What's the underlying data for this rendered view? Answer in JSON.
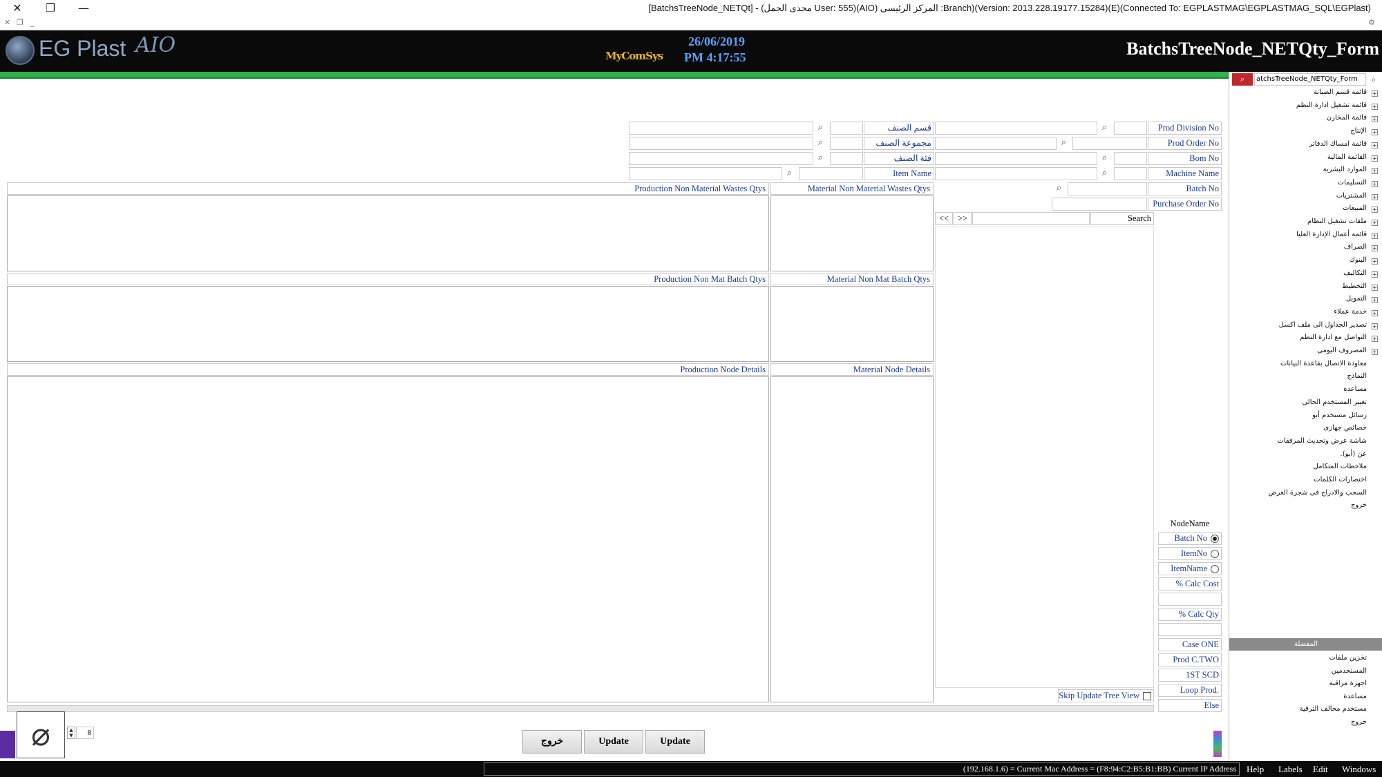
{
  "window": {
    "title": "[BatchsTreeNode_NETQt] - (مجدى الجمل User: 555)(AIO) المركز الرئيسى :Branch)(Version: 2013.228.19177.15284)(E)(Connected To: EGPLASTMAG\\EGPLASTMAG_SQL\\EGPlast)",
    "close": "✕",
    "restore": "❐",
    "minimize": "—"
  },
  "header": {
    "logo": "EG Plast",
    "logo_suffix": "AIO",
    "company_mark": "MyComSys",
    "date": "26/06/2019",
    "time": "PM 4:17:55",
    "form_title": "BatchsTreeNode_NETQty_Form"
  },
  "fields": {
    "prod_division_no": "Prod Division No",
    "prod_order_no": "Prod Order No",
    "bom_no": "Bom No",
    "machine_name": "Machine Name",
    "batch_no": "Batch No",
    "purchase_order_no": "Purchase Order No",
    "item_section": "قسم الصنف",
    "item_group": "مجموعة الصنف",
    "item_category": "فئة الصنف",
    "item_name": "Item Name",
    "search": "Search",
    "prev": "<<",
    "next": ">>"
  },
  "panels": {
    "prod_non_mat_wastes": "Production Non Material Wastes Qtys",
    "mat_non_mat_wastes": "Material Non Material Wastes Qtys",
    "prod_non_mat_batch": "Production Non Mat Batch Qtys",
    "mat_non_mat_batch": "Material Non Mat Batch Qtys",
    "prod_node_details": "Production Node Details",
    "mat_node_details": "Material Node Details"
  },
  "options": {
    "node_name_label": "NodeName",
    "batch_no": "Batch No",
    "item_no": "ItemNo",
    "item_name": "ItemName",
    "calc_cost": "% Calc  Cost",
    "calc_qty": "% Calc  Qty",
    "case_one": "Case ONE",
    "prod_c_two": "Prod C.TWO",
    "first_scd": "1ST SCD",
    "loop_prod": "Loop Prod.",
    "else": "Else",
    "skip_update": "Skip Update Tree View"
  },
  "buttons": {
    "exit": "خروج",
    "update1": "Update",
    "update2": "Update",
    "page_value": "8"
  },
  "nav": {
    "search_value": "atchsTreeNode_NETQty_Form",
    "items": [
      "قائمة قسم الصيانة",
      "قائمة تشغيل ادارة النظم",
      "قائمة المخازن",
      "الإنتاج",
      "قائمة امساك الدفاتر",
      "القائمة المالية",
      "الموارد البشرية",
      "التسليمات",
      "المشتريات",
      "المبيعات",
      "ملفات تشغيل النظام",
      "قائمة أعمال الإدارة العليا",
      "الصراف",
      "البنوك",
      "التكاليف",
      "التخطيط",
      "التمويل",
      "خدمة عملاء",
      "تصدير الجداول الى ملف اكسل",
      "التواصل مع ادارة النظم",
      "المصروف اليومى",
      "معاودة الاتصال بقاعدة البيانات",
      "النماذج",
      "مساعدة",
      "تغيير المستخدم الحالى",
      "رسائل مستخدم أبو",
      "خصائص جهازى",
      "شاشة عرض وتحديث المرفقات",
      "عن (أبو).",
      "ملاحظات المتكامل",
      "اختصارات الكلمات",
      "السحب والادراج فى شجرة العرض",
      "خروج"
    ],
    "favorites_title": "المفضلة",
    "favorites": [
      "تخزين ملفات",
      "المستخدمين",
      "اجهزة مراقبة",
      "مساعدة",
      "مستخدم مخالف الترقية",
      "خروج"
    ]
  },
  "statusbar": {
    "info": "(192.168.1.6) = Current Mac Address = (F8:94:C2:B5:B1:BB) Current IP Address",
    "menus": [
      "Help",
      "Labels",
      "Edit",
      "Windows"
    ]
  },
  "colors": {
    "header_bg": "#0a0a0a",
    "green_bar": "#2fb34a",
    "label_text": "#1a3b8f",
    "date_text": "#5aa3ff"
  }
}
